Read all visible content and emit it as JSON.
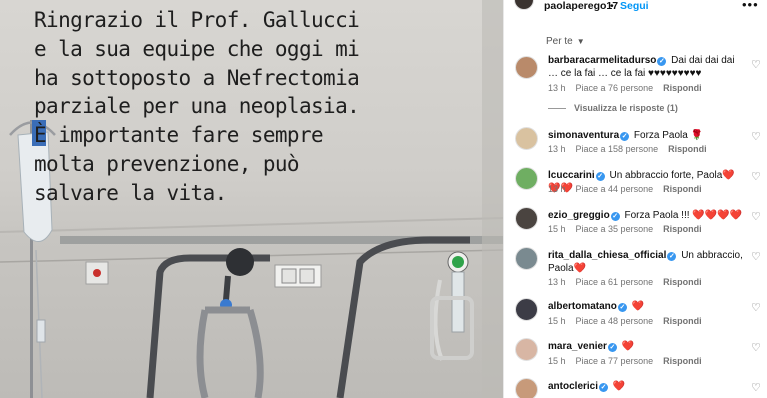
{
  "post": {
    "username": "paolaperego17",
    "separator": "•",
    "follow_label": "Segui",
    "more_icon": "more-horizontal-icon",
    "caption": "Ringrazio il Prof. Gallucci\ne la sua equipe che oggi mi\nha sottoposto a Nefrectomia\nparziale per una neoplasia.\nÈ importante fare sempre\nmolta prevenzione, può\nsalvare la vita."
  },
  "sort": {
    "label": "Per te",
    "icon": "chevron-down-icon"
  },
  "comments": [
    {
      "user": "barbaracarmelitadurso",
      "verified": true,
      "text": "Dai dai dai dai … ce la fai … ce la fai ♥♥♥♥♥♥♥♥♥",
      "age": "13 h",
      "likes": "Piace a 76 persone",
      "reply": "Rispondi",
      "avatar_color": "#b98a6a"
    },
    {
      "user": "simonaventura",
      "verified": true,
      "text": "Forza Paola 🌹",
      "age": "13 h",
      "likes": "Piace a 158 persone",
      "reply": "Rispondi",
      "avatar_color": "#d9c2a0"
    },
    {
      "user": "lcuccarini",
      "verified": true,
      "text": "Un abbraccio forte, Paola❤️❤️❤️",
      "age": "13 h",
      "likes": "Piace a 44 persone",
      "reply": "Rispondi",
      "avatar_color": "#6fae62"
    },
    {
      "user": "ezio_greggio",
      "verified": true,
      "text": "Forza Paola !!! ❤️❤️❤️❤️",
      "age": "15 h",
      "likes": "Piace a 35 persone",
      "reply": "Rispondi",
      "avatar_color": "#4a4440"
    },
    {
      "user": "rita_dalla_chiesa_official",
      "verified": true,
      "text": "Un abbraccio, Paola❤️",
      "age": "13 h",
      "likes": "Piace a 61 persone",
      "reply": "Rispondi",
      "avatar_color": "#7a8a90"
    },
    {
      "user": "albertomatano",
      "verified": true,
      "text": "❤️",
      "age": "15 h",
      "likes": "Piace a 48 persone",
      "reply": "Rispondi",
      "avatar_color": "#3c3c46"
    },
    {
      "user": "mara_venier",
      "verified": true,
      "text": "❤️",
      "age": "15 h",
      "likes": "Piace a 77 persone",
      "reply": "Rispondi",
      "avatar_color": "#d8b6a4"
    },
    {
      "user": "antoclerici",
      "verified": true,
      "text": "❤️",
      "age": "",
      "likes": "",
      "reply": "",
      "avatar_color": "#c79a7a"
    }
  ],
  "view_replies": "Visualizza le risposte (1)",
  "like_icon": "heart-outline-icon"
}
